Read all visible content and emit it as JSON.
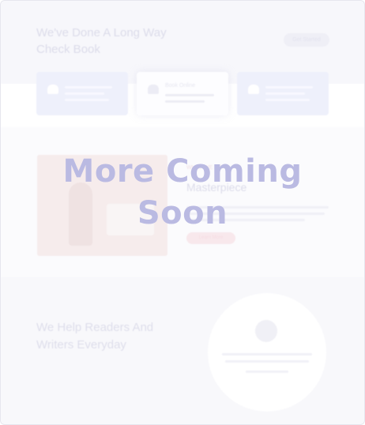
{
  "overlay": {
    "line1": "More Coming",
    "line2": "Soon"
  },
  "faded_page": {
    "hero": {
      "heading": "We've Done A Long Way",
      "heading2": "Check Book",
      "button_label": "Get Started"
    },
    "cards": [
      {
        "title": "",
        "close": "×"
      },
      {
        "title": "Book Online",
        "close": "×"
      },
      {
        "title": "",
        "close": "×"
      }
    ],
    "feature": {
      "tag": "WHAT WE DO",
      "heading": "Masterpiece",
      "button_label": "Learn More"
    },
    "help": {
      "heading": "We Help Readers And",
      "heading2": "Writers Everyday"
    }
  },
  "colors": {
    "overlay_text": "#babae2",
    "background": "#ffffff",
    "border": "#e6e6ee"
  }
}
